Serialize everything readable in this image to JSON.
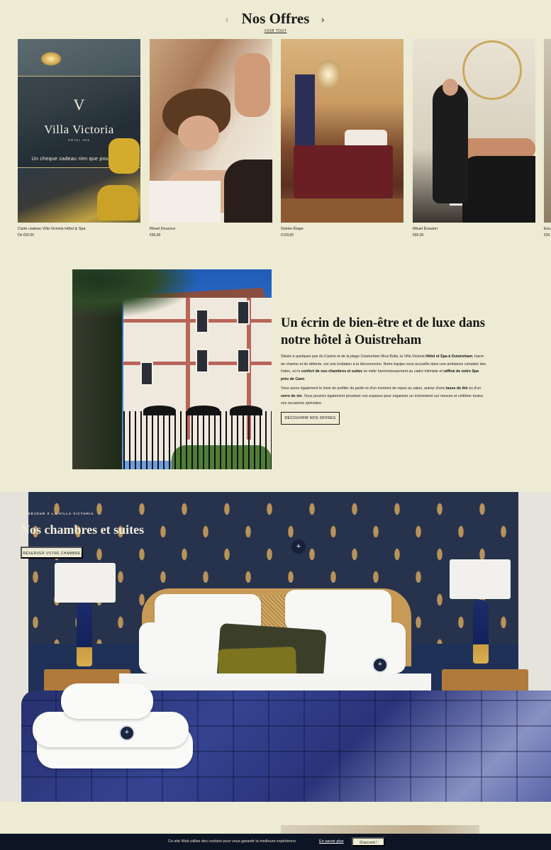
{
  "offers": {
    "title": "Nos Offres",
    "voir_tout": "VOIR TOUT",
    "prev_arrow": "‹",
    "next_arrow": "›",
    "cards": [
      {
        "name": "Carte cadeau Villa Victoria Hôtel & Spa",
        "price": "Dè €50,00",
        "overlay": {
          "mark": "V",
          "brand": "Villa Victoria",
          "sub": "HÔTEL SPA",
          "tagline": "Un cheque cadeau rien que pour vous !"
        }
      },
      {
        "name": "Rituel Douceur",
        "price": "€95,00"
      },
      {
        "name": "Soirée Étape",
        "price": "€139,00"
      },
      {
        "name": "Rituel Évasion",
        "price": "€99,00"
      },
      {
        "name": "Esca",
        "price": "€20"
      }
    ]
  },
  "about": {
    "title": "Un écrin de bien-être et de luxe dans notre hôtel à Ouistreham",
    "p1_a": "Située à quelques pas du Casino et de la plage Ouistreham Riva Bella, la Villa Victoria ",
    "p1_b": "Hôtel et Spa à Ouistreham",
    "p1_c": ", havre de charme et de détente, est une invitation à la déconnexion. Notre équipe vous accueille dans une ambiance comptoir des Indes, où le ",
    "p1_d": "confort de nos chambres et suites",
    "p1_e": " se mêle harmonieusement au cadre intimiste et ",
    "p1_f": "raffiné de notre Spa près de Caen",
    "p1_g": ".",
    "p2_a": "Vous aurez également le loisir de profiter du jardin et d'un moment de repos au salon, autour d'une ",
    "p2_b": "tasse de thé",
    "p2_c": " ou d'un ",
    "p2_d": "verre de vin",
    "p2_e": ". Vous pourrez également privatiser ces espaces pour organiser un événement sur mesure et célébrer toutes vos occasions spéciales.",
    "button": "DÉCOUVRIR NOS OFFRES"
  },
  "rooms": {
    "eyebrow": "UN SÉJOUR À LA VILLA VICTORIA",
    "title": "Nos chambres et suites",
    "button": "RÉSERVER VOTRE CHAMBRE",
    "hotspot_label": "+"
  },
  "cookie": {
    "text": "Ce site Web utilise des cookies pour vous garantir la meilleure expérience.",
    "link": "En savoir plus",
    "accept": "D'accord !"
  },
  "colors": {
    "background": "#edebd3",
    "navy": "#0d1524",
    "gold": "#c9a95a"
  }
}
